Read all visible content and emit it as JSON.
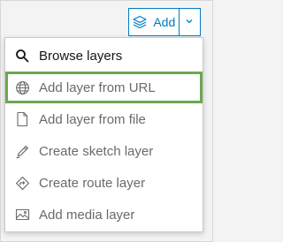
{
  "add_button": {
    "label": "Add",
    "icon": "layers-add-icon",
    "caret_icon": "chevron-down-icon"
  },
  "menu": {
    "items": [
      {
        "label": "Browse layers",
        "icon": "search-icon",
        "state": "enabled"
      },
      {
        "label": "Add layer from URL",
        "icon": "globe-icon",
        "state": "highlighted"
      },
      {
        "label": "Add layer from file",
        "icon": "file-icon",
        "state": "enabled"
      },
      {
        "label": "Create sketch layer",
        "icon": "pencil-icon",
        "state": "enabled"
      },
      {
        "label": "Create route layer",
        "icon": "route-icon",
        "state": "enabled"
      },
      {
        "label": "Add media layer",
        "icon": "image-icon",
        "state": "enabled"
      }
    ]
  },
  "colors": {
    "accent": "#007ac2",
    "highlight_border": "#6aa84f",
    "text_primary": "#151515",
    "text_secondary": "#6a6a6a"
  }
}
